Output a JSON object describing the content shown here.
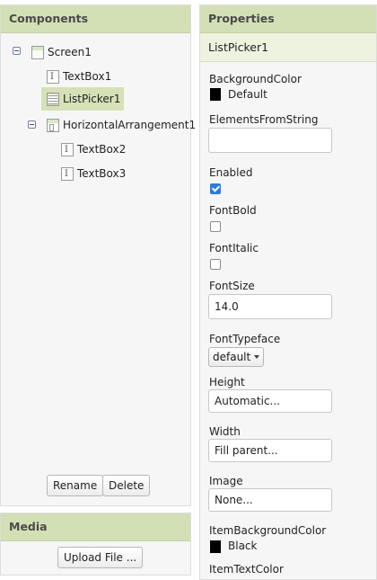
{
  "components": {
    "title": "Components",
    "tree": [
      {
        "label": "Screen1",
        "icon": "screen-icon"
      },
      {
        "label": "TextBox1",
        "icon": "textbox-icon"
      },
      {
        "label": "ListPicker1",
        "icon": "listpicker-icon"
      },
      {
        "label": "HorizontalArrangement1",
        "icon": "horizontal-arrangement-icon"
      },
      {
        "label": "TextBox2",
        "icon": "textbox-icon"
      },
      {
        "label": "TextBox3",
        "icon": "textbox-icon"
      }
    ],
    "rename_label": "Rename",
    "delete_label": "Delete"
  },
  "media": {
    "title": "Media",
    "upload_label": "Upload File ..."
  },
  "properties": {
    "title": "Properties",
    "selected_component": "ListPicker1",
    "background_color": {
      "label": "BackgroundColor",
      "value": "Default",
      "swatch": "#000000"
    },
    "elements_from_string": {
      "label": "ElementsFromString",
      "value": ""
    },
    "enabled": {
      "label": "Enabled",
      "checked": true
    },
    "font_bold": {
      "label": "FontBold",
      "checked": false
    },
    "font_italic": {
      "label": "FontItalic",
      "checked": false
    },
    "font_size": {
      "label": "FontSize",
      "value": "14.0"
    },
    "font_typeface": {
      "label": "FontTypeface",
      "value": "default"
    },
    "height": {
      "label": "Height",
      "value": "Automatic..."
    },
    "width": {
      "label": "Width",
      "value": "Fill parent..."
    },
    "image": {
      "label": "Image",
      "value": "None..."
    },
    "item_background_color": {
      "label": "ItemBackgroundColor",
      "value": "Black",
      "swatch": "#000000"
    },
    "item_text_color": {
      "label": "ItemTextColor"
    }
  },
  "colors": {
    "header_bg": "#d3e0b5",
    "checkbox_accent": "#2d7be0"
  }
}
